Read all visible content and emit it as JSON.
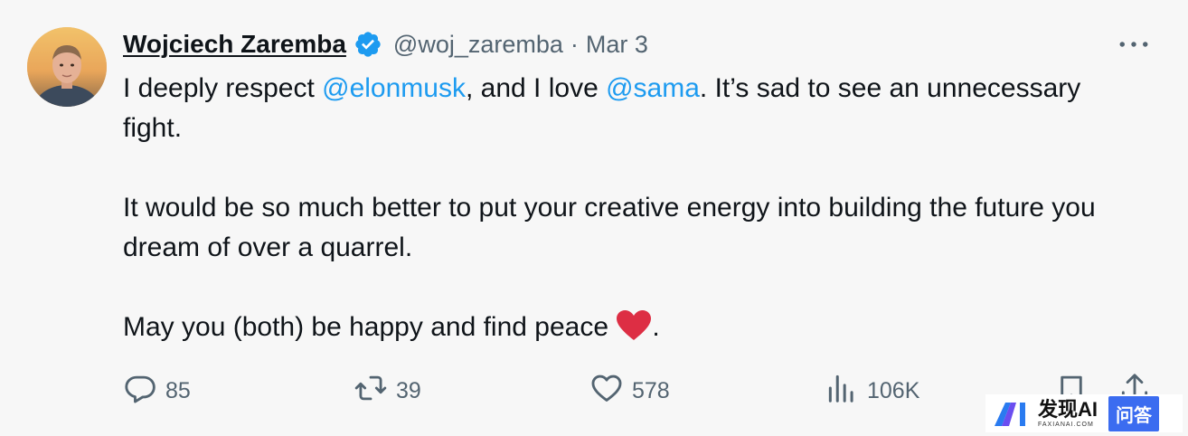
{
  "author": {
    "display_name": "Wojciech Zaremba",
    "handle": "@woj_zaremba",
    "separator": "·",
    "date": "Mar 3",
    "verified": true
  },
  "icons": {
    "verified": "verified-badge-icon",
    "more": "more-options-icon",
    "reply": "reply-icon",
    "retweet": "retweet-icon",
    "like": "heart-outline-icon",
    "views": "views-bar-chart-icon",
    "bookmark": "bookmark-icon",
    "share": "share-icon",
    "heart_emoji": "red-heart-emoji"
  },
  "tweet": {
    "para1_prefix": "I deeply respect ",
    "mention1": "@elonmusk",
    "para1_middle": ", and I love ",
    "mention2": "@sama",
    "para1_suffix": ". It’s sad to see an unnecessary fight.",
    "para2": "It would be so much better to put your creative energy into building the future you dream of over a quarrel.",
    "para3_prefix": "May you (both) be happy and find peace ",
    "para3_suffix": "."
  },
  "metrics": {
    "replies": "85",
    "retweets": "39",
    "likes": "578",
    "views": "106K"
  },
  "watermark": {
    "brand": "发现AI",
    "url": "FAXIANAI.COM",
    "badge": "问答"
  },
  "colors": {
    "background": "#f7f7f7",
    "text": "#0f1419",
    "secondary": "#536471",
    "link": "#1d9bf0",
    "verified": "#1d9bf0",
    "heart": "#e0245e"
  }
}
